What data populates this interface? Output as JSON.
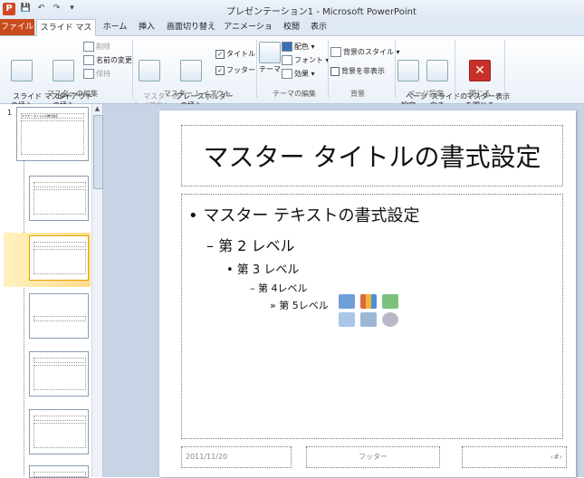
{
  "window": {
    "title": "プレゼンテーション1 - Microsoft PowerPoint",
    "app_icon": "P"
  },
  "qat": {
    "save": "💾",
    "undo": "↶",
    "redo": "↷",
    "customize": "▾"
  },
  "tabs": [
    "ファイル",
    "スライド マスター",
    "ホーム",
    "挿入",
    "画面切り替え",
    "アニメーション",
    "校閲",
    "表示"
  ],
  "ribbon": {
    "insert_slide_master": "スライド マスター\nの挿入",
    "insert_layout": "レイアウト\nの挿入",
    "delete": "削除",
    "rename": "名前の変更",
    "preserve": "保持",
    "group_master_edit": "マスターの編集",
    "master_layout": "マスターの\nレイアウト",
    "insert_placeholder": "プレースホルダー\nの挿入",
    "title_checkbox": "タイトル",
    "footer_checkbox": "フッター",
    "group_master_layout": "マスター レイアウト",
    "theme": "テーマ",
    "colors": "配色",
    "fonts": "フォント",
    "effects": "効果",
    "group_theme_edit": "テーマの編集",
    "background_styles": "背景のスタイル",
    "hide_background": "背景を非表示",
    "group_background": "背景",
    "page_setup": "ページ\n設定",
    "slide_orientation": "スライドの\n向き",
    "group_page_setup": "ページ設定",
    "close_master": "マスター表示\nを閉じる",
    "group_close": "閉じる"
  },
  "thumbnails": {
    "first_number": "1",
    "first_title": "マスター タイトルの書式設定"
  },
  "slide": {
    "title": "マスター タイトルの書式設定",
    "level1": "• マスター テキストの書式設定",
    "level2": "– 第 2 レベル",
    "level3": "• 第 3 レベル",
    "level4": "– 第 4レベル",
    "level5": "» 第 5レベル",
    "date": "2011/11/20",
    "footer": "フッター",
    "page": "‹#›"
  }
}
